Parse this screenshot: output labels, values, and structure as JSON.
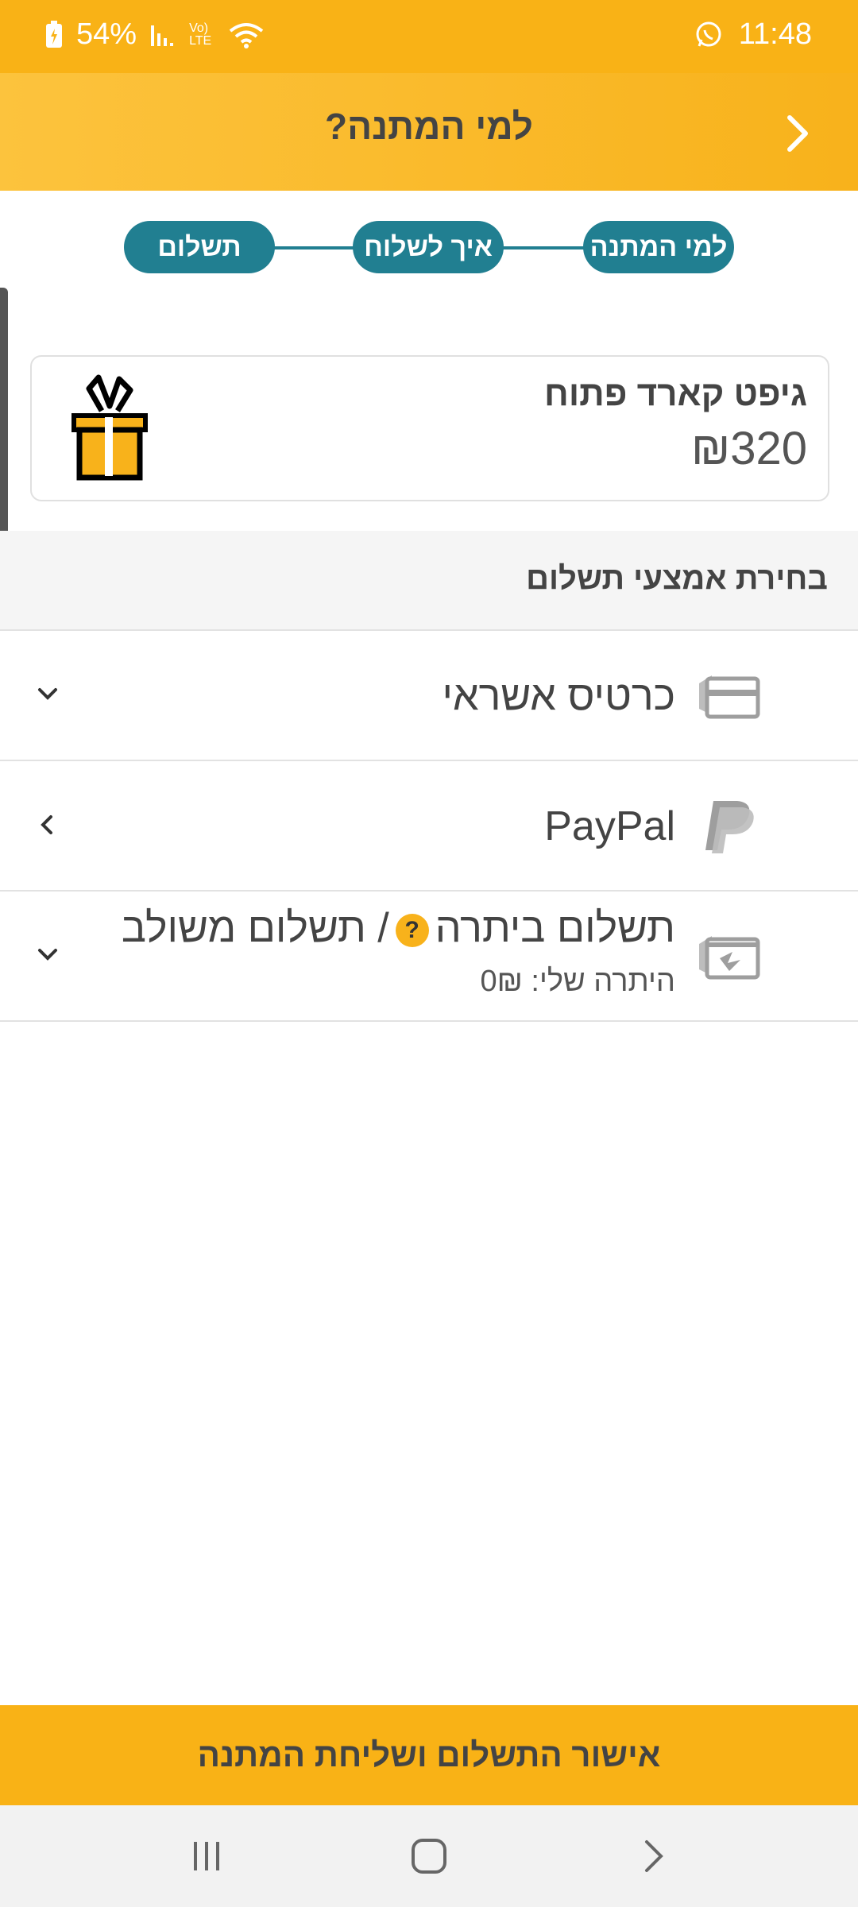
{
  "status_bar": {
    "battery": "54%",
    "time": "11:48",
    "network": "Vo) LTE"
  },
  "header": {
    "title": "למי המתנה?"
  },
  "stepper": {
    "steps": [
      "למי המתנה",
      "איך לשלוח",
      "תשלום"
    ]
  },
  "gift_card": {
    "name": "גיפט קארד פתוח",
    "price": "₪320"
  },
  "payment": {
    "section_title": "בחירת אמצעי תשלום",
    "methods": [
      {
        "label": "כרטיס אשראי",
        "icon": "credit-card-icon"
      },
      {
        "label": "PayPal",
        "icon": "paypal-icon"
      },
      {
        "label_part1": "תשלום ביתרה",
        "help": "?",
        "label_part2": "/ תשלום משולב",
        "balance": "היתרה שלי: 0₪",
        "icon": "balance-card-icon"
      }
    ]
  },
  "confirm_button": {
    "label": "אישור התשלום ושליחת המתנה"
  },
  "colors": {
    "accent": "#f9b216",
    "teal": "#217f91"
  }
}
